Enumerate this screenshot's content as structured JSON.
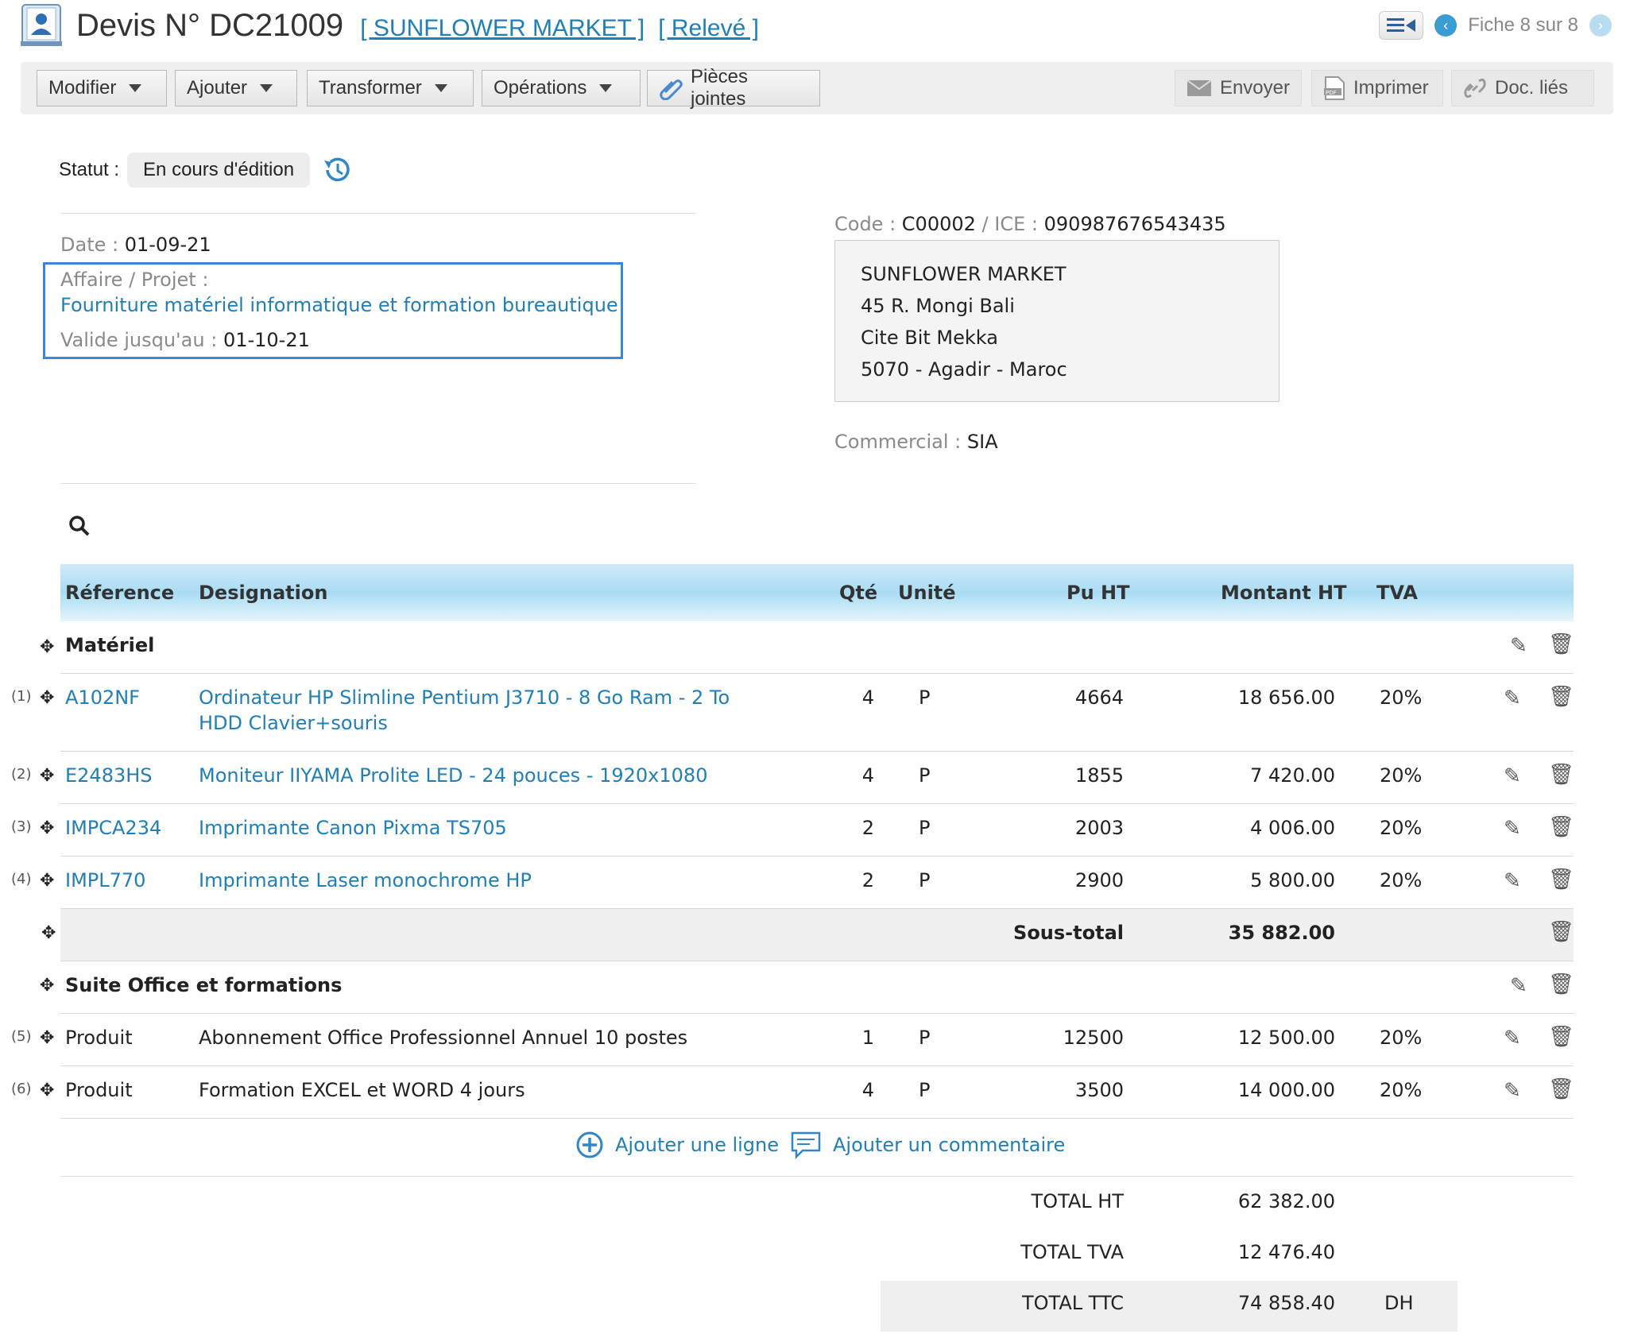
{
  "header": {
    "title": "Devis N° DC21009",
    "customer_link": "[ SUNFLOWER MARKET ]",
    "statement_link": "[ Relevé ]",
    "record_nav": "Fiche 8 sur 8"
  },
  "toolbar": {
    "modify": "Modifier",
    "add": "Ajouter",
    "transform": "Transformer",
    "operations": "Opérations",
    "attachments": "Pièces jointes",
    "send": "Envoyer",
    "print": "Imprimer",
    "linked_docs": "Doc. liés"
  },
  "status": {
    "label": "Statut :",
    "value": "En cours d'édition"
  },
  "info": {
    "date_label": "Date :",
    "date_value": "01-09-21",
    "project_label": "Affaire / Projet :",
    "project_value": "Fourniture matériel informatique et formation bureautique",
    "valid_label": "Valide jusqu'au :",
    "valid_value": "01-10-21"
  },
  "customer": {
    "code_label": "Code :",
    "code_value": "C00002",
    "sep": "/",
    "ice_label": "ICE :",
    "ice_value": "090987676543435",
    "address": [
      "SUNFLOWER MARKET",
      "45 R. Mongi Bali",
      "Cite Bit Mekka",
      "5070 - Agadir - Maroc"
    ],
    "commercial_label": "Commercial :",
    "commercial_value": "SIA"
  },
  "table": {
    "headers": {
      "reference": "Réference",
      "designation": "Designation",
      "qty": "Qté",
      "unit": "Unité",
      "pu_ht": "Pu HT",
      "amount_ht": "Montant HT",
      "tva": "TVA"
    },
    "group1": "Matériel",
    "group2": "Suite Office et formations",
    "subtotal_label": "Sous-total",
    "subtotal_value": "35 882.00",
    "rows": [
      {
        "num": "(1)",
        "ref": "A102NF",
        "des1": "Ordinateur HP Slimline Pentium J3710 - 8 Go Ram - 2 To",
        "des2": "HDD Clavier+souris",
        "qty": "4",
        "unit": "P",
        "pu": "4664",
        "amount": "18 656.00",
        "tva": "20%"
      },
      {
        "num": "(2)",
        "ref": "E2483HS",
        "des1": "Moniteur IIYAMA Prolite LED - 24 pouces - 1920x1080",
        "des2": "",
        "qty": "4",
        "unit": "P",
        "pu": "1855",
        "amount": "7 420.00",
        "tva": "20%"
      },
      {
        "num": "(3)",
        "ref": "IMPCA234",
        "des1": "Imprimante Canon Pixma TS705",
        "des2": "",
        "qty": "2",
        "unit": "P",
        "pu": "2003",
        "amount": "4 006.00",
        "tva": "20%"
      },
      {
        "num": "(4)",
        "ref": "IMPL770",
        "des1": "Imprimante Laser monochrome HP",
        "des2": "",
        "qty": "2",
        "unit": "P",
        "pu": "2900",
        "amount": "5 800.00",
        "tva": "20%"
      },
      {
        "num": "(5)",
        "ref": "Produit",
        "des1": "Abonnement Office Professionnel Annuel 10 postes",
        "des2": "",
        "qty": "1",
        "unit": "P",
        "pu": "12500",
        "amount": "12 500.00",
        "tva": "20%"
      },
      {
        "num": "(6)",
        "ref": "Produit",
        "des1": "Formation EXCEL et WORD 4 jours",
        "des2": "",
        "qty": "4",
        "unit": "P",
        "pu": "3500",
        "amount": "14 000.00",
        "tva": "20%"
      }
    ]
  },
  "actions": {
    "add_line": "Ajouter une ligne",
    "add_comment": "Ajouter un commentaire"
  },
  "totals": {
    "ht_label": "TOTAL HT",
    "ht_value": "62 382.00",
    "tva_label": "TOTAL TVA",
    "tva_value": "12 476.40",
    "ttc_label": "TOTAL TTC",
    "ttc_value": "74 858.40",
    "currency": "DH"
  },
  "colors": {
    "link": "#1f7fb6",
    "header_gradient": "#a9dcf3",
    "focus_border": "#3b86d8"
  }
}
